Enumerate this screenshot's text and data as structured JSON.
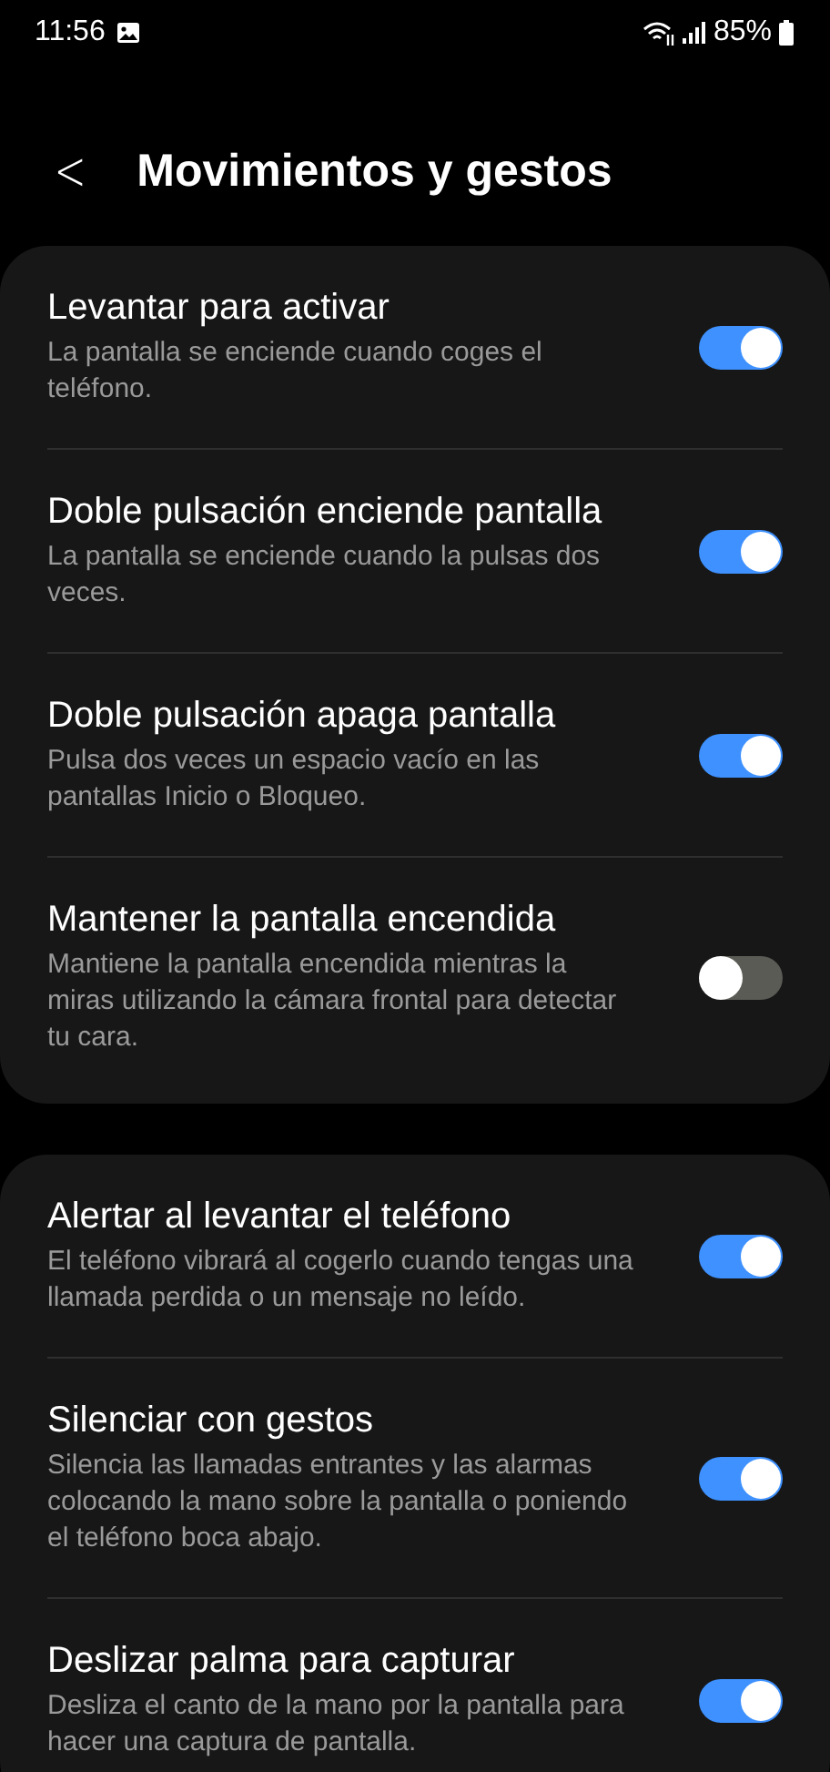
{
  "status_bar": {
    "time": "11:56",
    "battery": "85%"
  },
  "header": {
    "back": "<",
    "title": "Movimientos y gestos"
  },
  "groups": [
    {
      "items": [
        {
          "title": "Levantar para activar",
          "description": "La pantalla se enciende cuando coges el teléfono.",
          "on": true
        },
        {
          "title": "Doble pulsación enciende pantalla",
          "description": "La pantalla se enciende cuando la pulsas dos veces.",
          "on": true
        },
        {
          "title": "Doble pulsación apaga pantalla",
          "description": "Pulsa dos veces un espacio vacío en las pantallas Inicio o Bloqueo.",
          "on": true
        },
        {
          "title": "Mantener la pantalla encendida",
          "description": "Mantiene la pantalla encendida mientras la miras utilizando la cámara frontal para detectar tu cara.",
          "on": false
        }
      ]
    },
    {
      "items": [
        {
          "title": "Alertar al levantar el teléfono",
          "description": "El teléfono vibrará al cogerlo cuando tengas una llamada perdida o un mensaje no leído.",
          "on": true
        },
        {
          "title": "Silenciar con gestos",
          "description": "Silencia las llamadas entrantes y las alarmas colocando la mano sobre la pantalla o poniendo el teléfono boca abajo.",
          "on": true
        },
        {
          "title": "Deslizar palma para capturar",
          "description": "Desliza el canto de la mano por la pantalla para hacer una captura de pantalla.",
          "on": true
        }
      ]
    }
  ]
}
